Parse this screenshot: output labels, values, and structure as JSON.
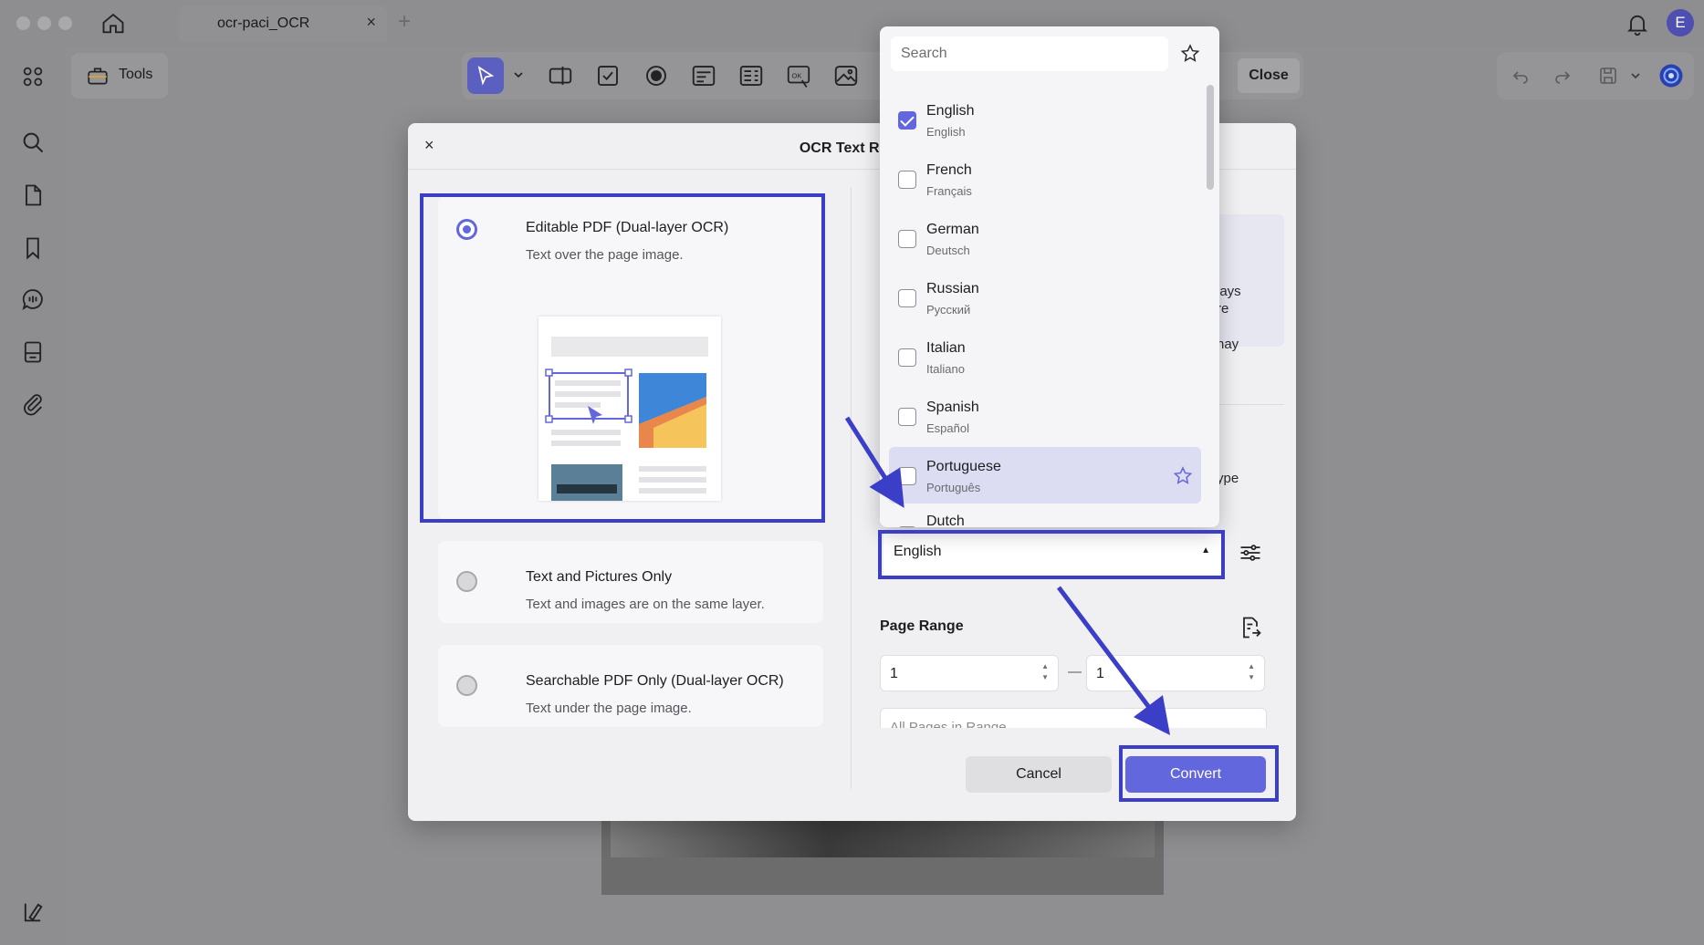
{
  "window": {
    "tab_title": "ocr-paci_OCR",
    "tab_close": "×",
    "tab_add": "+",
    "avatar_initial": "E"
  },
  "toolbar": {
    "tools_label": "Tools",
    "close_label": "Close"
  },
  "dialog": {
    "title": "OCR Text Reco",
    "close_symbol": "×",
    "options": [
      {
        "title": "Editable PDF (Dual-layer OCR)",
        "desc": "Text over the page image.",
        "selected": true
      },
      {
        "title": "Text and Pictures Only",
        "desc": "Text and images are on the same layer.",
        "selected": false
      },
      {
        "title": "Searchable PDF Only (Dual-layer OCR)",
        "desc": "Text under the page image.",
        "selected": false
      }
    ],
    "right_fragments": [
      "lays",
      "re",
      "nay",
      "ype"
    ],
    "language_value": "English",
    "language_caret": "▲",
    "page_range_label": "Page Range",
    "range_from": "1",
    "range_to": "1",
    "range_dash": "—",
    "range_subset": "All Pages in Range",
    "cancel_label": "Cancel",
    "convert_label": "Convert"
  },
  "language_popup": {
    "search_placeholder": "Search",
    "languages": [
      {
        "name": "English",
        "native": "English",
        "checked": true
      },
      {
        "name": "French",
        "native": "Français",
        "checked": false
      },
      {
        "name": "German",
        "native": "Deutsch",
        "checked": false
      },
      {
        "name": "Russian",
        "native": "Русский",
        "checked": false
      },
      {
        "name": "Italian",
        "native": "Italiano",
        "checked": false
      },
      {
        "name": "Spanish",
        "native": "Español",
        "checked": false
      },
      {
        "name": "Portuguese",
        "native": "Português",
        "checked": false,
        "hovered": true
      },
      {
        "name": "Dutch",
        "native": "",
        "checked": false
      }
    ]
  },
  "colors": {
    "accent": "#6367dd",
    "annotation": "#3b3ec6"
  },
  "icons": [
    "home-icon",
    "bell-icon",
    "grid-icon",
    "search-icon",
    "page-icon",
    "bookmark-icon",
    "comment-icon",
    "stack-icon",
    "attachment-icon",
    "sidebar-toggle-icon",
    "toolbox-icon",
    "select-arrow-icon",
    "star-icon",
    "adjust-icon",
    "page-range-icon"
  ]
}
